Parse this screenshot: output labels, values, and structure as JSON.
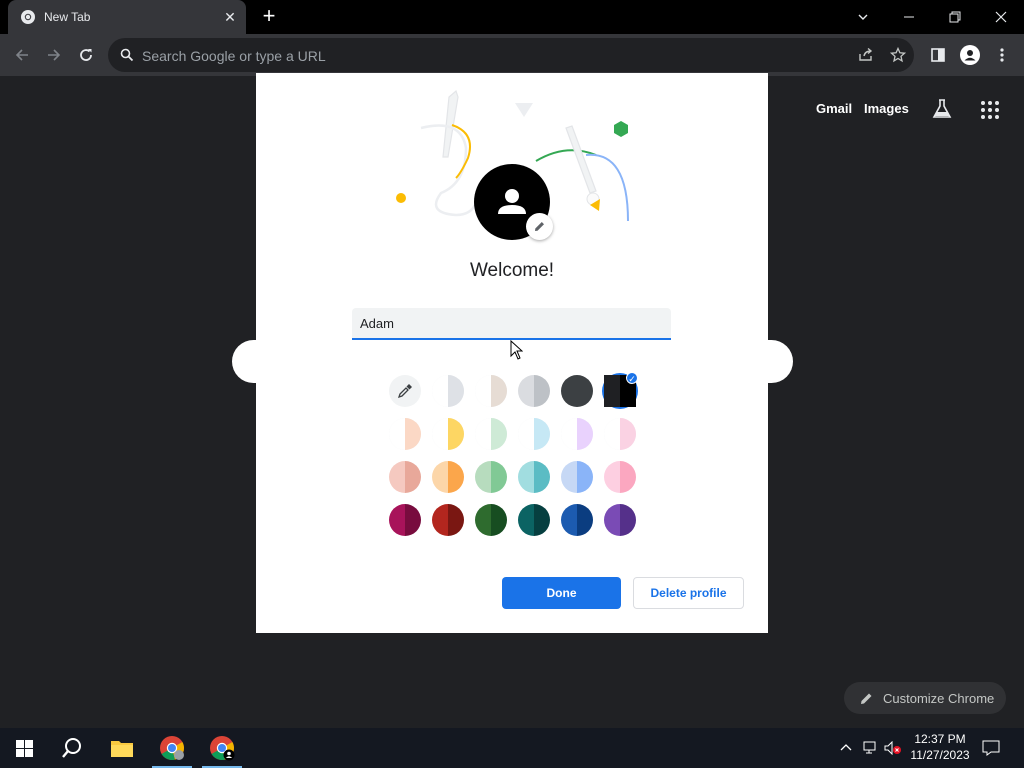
{
  "browser": {
    "tab_title": "New Tab",
    "omnibox_placeholder": "Search Google or type a URL"
  },
  "ntp": {
    "gmail": "Gmail",
    "images": "Images",
    "customize": "Customize Chrome"
  },
  "dialog": {
    "title": "Welcome!",
    "name_value": "Adam",
    "done": "Done",
    "delete": "Delete profile",
    "colors": [
      [
        [
          "#ffffff",
          "#ffffff"
        ],
        [
          "#ffffff",
          "#dee1e6"
        ],
        [
          "#ffffff",
          "#e6dcd4"
        ],
        [
          "#dadce0",
          "#bdc1c6"
        ],
        [
          "#3c4043",
          "#3c4043"
        ],
        [
          "#1f2023",
          "#000000"
        ]
      ],
      [
        [
          "#ffffff",
          "#fbd8c5"
        ],
        [
          "#ffffff",
          "#fdd663"
        ],
        [
          "#ffffff",
          "#ceead6"
        ],
        [
          "#ffffff",
          "#c6e8f5"
        ],
        [
          "#ffffff",
          "#e9d2fd"
        ],
        [
          "#ffffff",
          "#fad2e3"
        ]
      ],
      [
        [
          "#f5c9c0",
          "#e8a89a"
        ],
        [
          "#fcd6a9",
          "#fba64b"
        ],
        [
          "#b7dcbe",
          "#81c995"
        ],
        [
          "#a1dde0",
          "#5bbcc4"
        ],
        [
          "#c6d8f5",
          "#8ab4f8"
        ],
        [
          "#fdcfe1",
          "#fba7c0"
        ]
      ],
      [
        [
          "#a8135a",
          "#780c3e"
        ],
        [
          "#b3261e",
          "#7a1712"
        ],
        [
          "#2e6b2e",
          "#174d21"
        ],
        [
          "#0b6363",
          "#063f40"
        ],
        [
          "#1c5bb0",
          "#0b3d80"
        ],
        [
          "#7a4bb5",
          "#55308a"
        ]
      ]
    ],
    "selected_color": "row1-col6"
  },
  "taskbar": {
    "time": "12:37 PM",
    "date": "11/27/2023"
  }
}
